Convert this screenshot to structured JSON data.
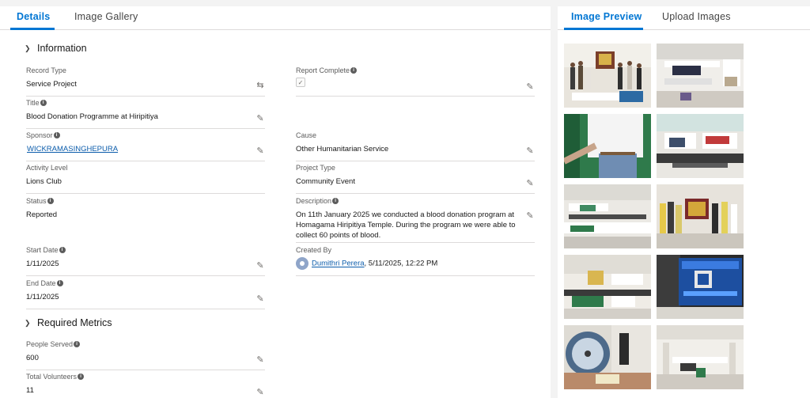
{
  "tabs_left": {
    "details": "Details",
    "gallery": "Image Gallery"
  },
  "tabs_right": {
    "preview": "Image Preview",
    "upload": "Upload Images"
  },
  "sections": {
    "information": "Information",
    "metrics": "Required Metrics"
  },
  "fields": {
    "record_type": {
      "label": "Record Type",
      "value": "Service Project"
    },
    "report_complete": {
      "label": "Report Complete",
      "checked": true
    },
    "title": {
      "label": "Title",
      "value": "Blood Donation Programme at Hiripitiya"
    },
    "sponsor": {
      "label": "Sponsor",
      "value": "WICKRAMASINGHEPURA"
    },
    "cause": {
      "label": "Cause",
      "value": "Other Humanitarian Service"
    },
    "activity_level": {
      "label": "Activity Level",
      "value": "Lions Club"
    },
    "project_type": {
      "label": "Project Type",
      "value": "Community Event"
    },
    "status": {
      "label": "Status",
      "value": "Reported"
    },
    "description": {
      "label": "Description",
      "value": "On 11th January 2025 we conducted a blood donation program at Homagama Hiripitiya Temple. During the program we were able to collect 60 points of blood."
    },
    "start_date": {
      "label": "Start Date",
      "value": "1/11/2025"
    },
    "created_by": {
      "label": "Created By",
      "user": "Dumithri Perera",
      "datetime": ", 5/11/2025, 12:22 PM"
    },
    "end_date": {
      "label": "End Date",
      "value": "1/11/2025"
    },
    "people_served": {
      "label": "People Served",
      "value": "600"
    },
    "total_volunteers": {
      "label": "Total Volunteers",
      "value": "11"
    }
  },
  "icons": {
    "edit": "pencil-icon",
    "info": "info-icon",
    "chevron": "chevron-down-icon",
    "swap": "record-type-change-icon"
  },
  "colors": {
    "accent": "#0176d3",
    "link": "#0b5cab",
    "border": "#dddbda"
  }
}
